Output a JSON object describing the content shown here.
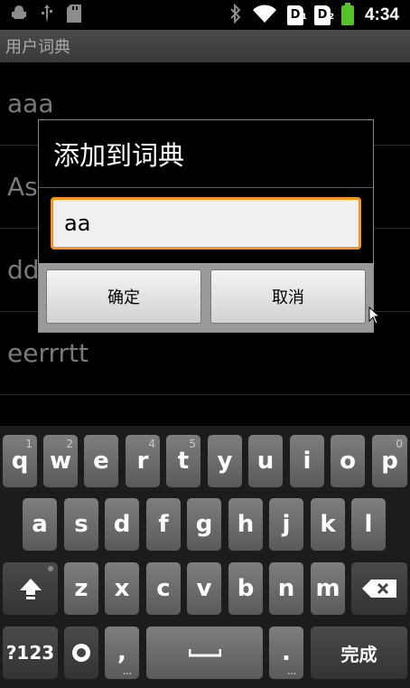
{
  "status_bar": {
    "left_icons": [
      "android-icon",
      "usb-icon",
      "sd-card-icon"
    ],
    "sim1": "1",
    "sim2": "2",
    "time": "4:34"
  },
  "title_bar": {
    "title": "用户词典"
  },
  "list": {
    "items": [
      "aaa",
      "As",
      "dd",
      "eerrrtt"
    ]
  },
  "dialog": {
    "title": "添加到词典",
    "input_value": "aa",
    "ok_label": "确定",
    "cancel_label": "取消"
  },
  "keyboard": {
    "row1": [
      {
        "label": "q",
        "hint": "1"
      },
      {
        "label": "w",
        "hint": "2"
      },
      {
        "label": "e",
        "hint": ""
      },
      {
        "label": "r",
        "hint": "4"
      },
      {
        "label": "t",
        "hint": "5"
      },
      {
        "label": "y",
        "hint": ""
      },
      {
        "label": "u",
        "hint": ""
      },
      {
        "label": "i",
        "hint": ""
      },
      {
        "label": "o",
        "hint": ""
      },
      {
        "label": "p",
        "hint": "0"
      }
    ],
    "row2": [
      "a",
      "s",
      "d",
      "f",
      "g",
      "h",
      "j",
      "k",
      "l"
    ],
    "row3": [
      "z",
      "x",
      "c",
      "v",
      "b",
      "n",
      "m"
    ],
    "symbols_label": "?123",
    "comma_label": ",",
    "period_label": ".",
    "done_label": "完成",
    "colors": {
      "key_light": "#7e7e7e",
      "key_dark": "#4a4a4a",
      "accent": "#f7931e"
    }
  }
}
